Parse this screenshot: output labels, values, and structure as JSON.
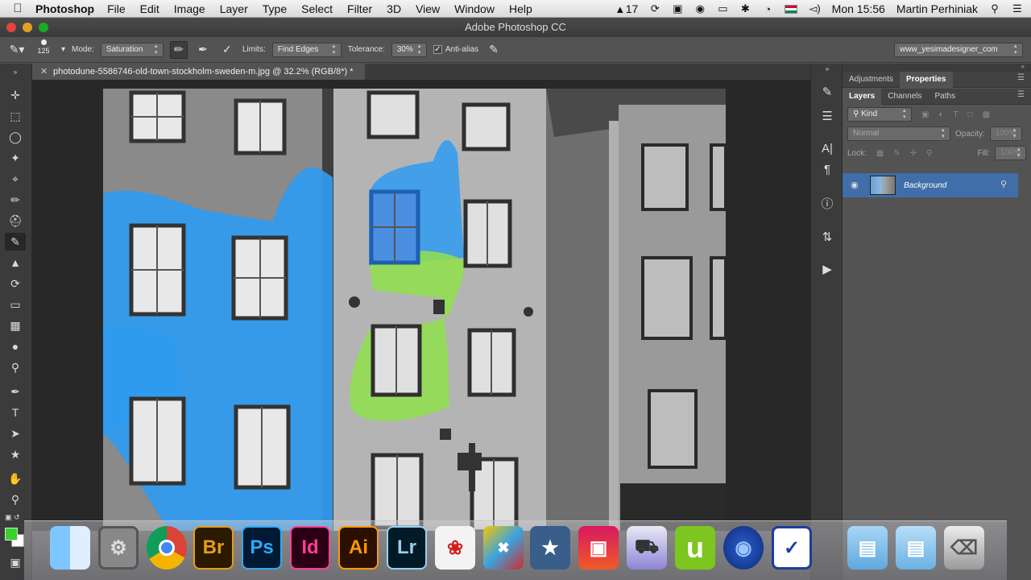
{
  "menubar": {
    "apple": "",
    "app_name": "Photoshop",
    "items": [
      "File",
      "Edit",
      "Image",
      "Layer",
      "Type",
      "Select",
      "Filter",
      "3D",
      "View",
      "Window",
      "Help"
    ],
    "status": {
      "adobe_count": "17",
      "clock": "Mon 15:56",
      "user": "Martin Perhiniak",
      "icons": [
        "adobe-creative-cloud-icon",
        "time-machine-icon",
        "photo-icon",
        "record-icon",
        "airplay-icon",
        "bluetooth-icon",
        "wifi-icon",
        "flag-icon",
        "volume-icon",
        "spotlight-icon",
        "notification-center-icon"
      ]
    }
  },
  "window": {
    "title": "Adobe Photoshop CC"
  },
  "options_bar": {
    "brush_size": "125",
    "mode_label": "Mode:",
    "mode_value": "Saturation",
    "limits_label": "Limits:",
    "limits_value": "Find Edges",
    "tolerance_label": "Tolerance:",
    "tolerance_value": "30%",
    "antialias_label": "Anti-alias",
    "antialias_checked": true,
    "workspace_value": "www_yesimadesigner_com"
  },
  "document": {
    "tab_title": "photodune-5586746-old-town-stockholm-sweden-m.jpg @ 32.2% (RGB/8*) *"
  },
  "panels": {
    "top_tabs": [
      "Adjustments",
      "Properties"
    ],
    "top_active": "Properties",
    "layer_tabs": [
      "Layers",
      "Channels",
      "Paths"
    ],
    "layer_active": "Layers",
    "kind_value": "Kind",
    "blend_value": "Normal",
    "opacity_label": "Opacity:",
    "opacity_value": "100%",
    "lock_label": "Lock:",
    "fill_label": "Fill:",
    "fill_value": "100%",
    "layers": [
      {
        "name": "Background",
        "locked": true,
        "visible": true
      }
    ]
  },
  "colors": {
    "foreground": "#39d12b",
    "background": "#ffffff",
    "paint_blue": "#2f9bf0",
    "paint_green": "#8fe14a"
  },
  "dock": {
    "apps": [
      {
        "name": "finder",
        "label": ""
      },
      {
        "name": "system-preferences",
        "label": ""
      },
      {
        "name": "chrome",
        "label": ""
      },
      {
        "name": "bridge",
        "label": "Br"
      },
      {
        "name": "photoshop",
        "label": "Ps"
      },
      {
        "name": "indesign",
        "label": "Id"
      },
      {
        "name": "illustrator",
        "label": "Ai"
      },
      {
        "name": "lightroom",
        "label": "Lr"
      },
      {
        "name": "acrobat",
        "label": ""
      },
      {
        "name": "extension-manager",
        "label": ""
      },
      {
        "name": "imovie",
        "label": ""
      },
      {
        "name": "photo-booth",
        "label": ""
      },
      {
        "name": "transmit",
        "label": ""
      },
      {
        "name": "utorrent",
        "label": "u"
      },
      {
        "name": "quicktime",
        "label": ""
      },
      {
        "name": "omnifocus",
        "label": ""
      },
      {
        "name": "applications-folder",
        "label": ""
      },
      {
        "name": "documents-folder",
        "label": ""
      },
      {
        "name": "trash",
        "label": ""
      }
    ]
  }
}
